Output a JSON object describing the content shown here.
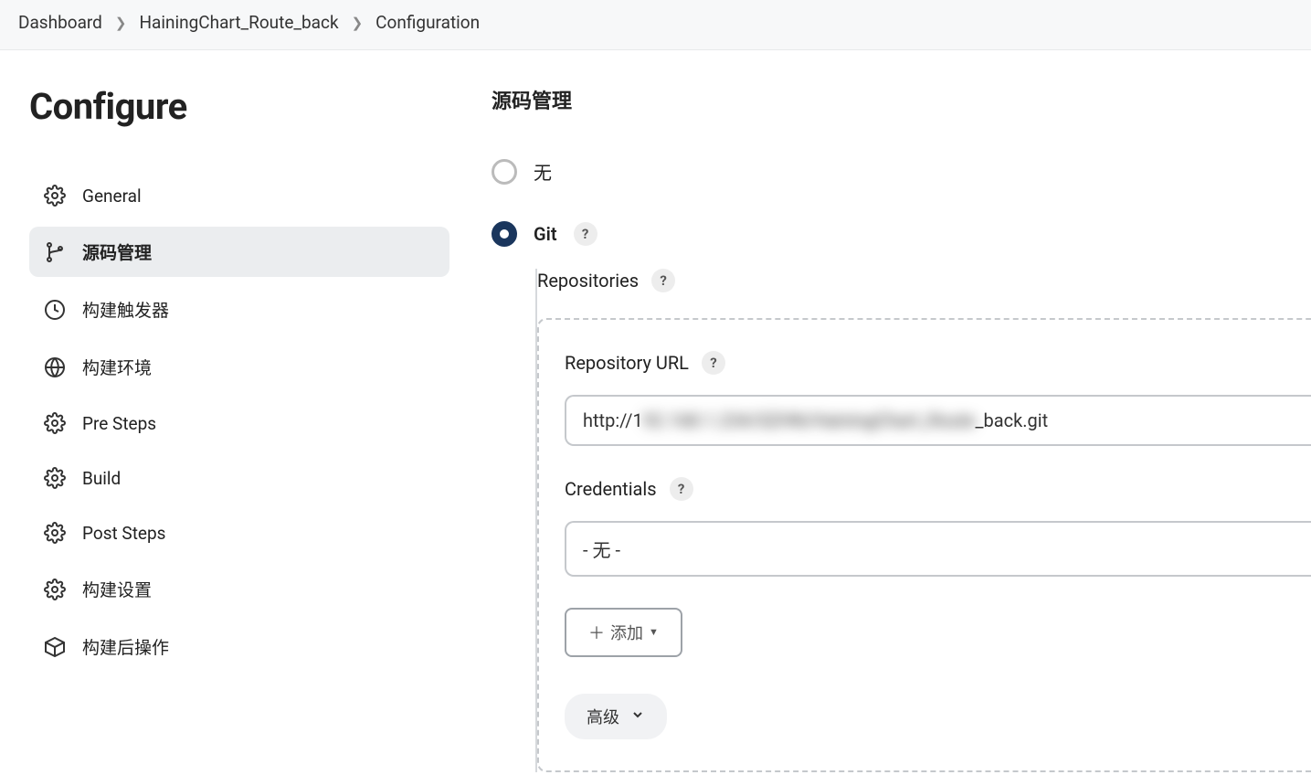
{
  "breadcrumb": {
    "items": [
      "Dashboard",
      "HainingChart_Route_back",
      "Configuration"
    ]
  },
  "sidebar": {
    "title": "Configure",
    "items": [
      {
        "label": "General",
        "icon": "gear"
      },
      {
        "label": "源码管理",
        "icon": "branch",
        "active": true
      },
      {
        "label": "构建触发器",
        "icon": "clock"
      },
      {
        "label": "构建环境",
        "icon": "globe"
      },
      {
        "label": "Pre Steps",
        "icon": "gear"
      },
      {
        "label": "Build",
        "icon": "gear"
      },
      {
        "label": "Post Steps",
        "icon": "gear"
      },
      {
        "label": "构建设置",
        "icon": "gear"
      },
      {
        "label": "构建后操作",
        "icon": "package"
      }
    ]
  },
  "main": {
    "section_title": "源码管理",
    "scm_none_label": "无",
    "scm_git_label": "Git",
    "repositories_label": "Repositories",
    "repo_url_label": "Repository URL",
    "repo_url_prefix": "http://1",
    "repo_url_redacted": "92.168.1.234/SZHN/HainingChart_Route",
    "repo_url_suffix": "_back.git",
    "credentials_label": "Credentials",
    "credentials_value": "- 无 -",
    "add_button_label": "添加",
    "advanced_label": "高级"
  }
}
